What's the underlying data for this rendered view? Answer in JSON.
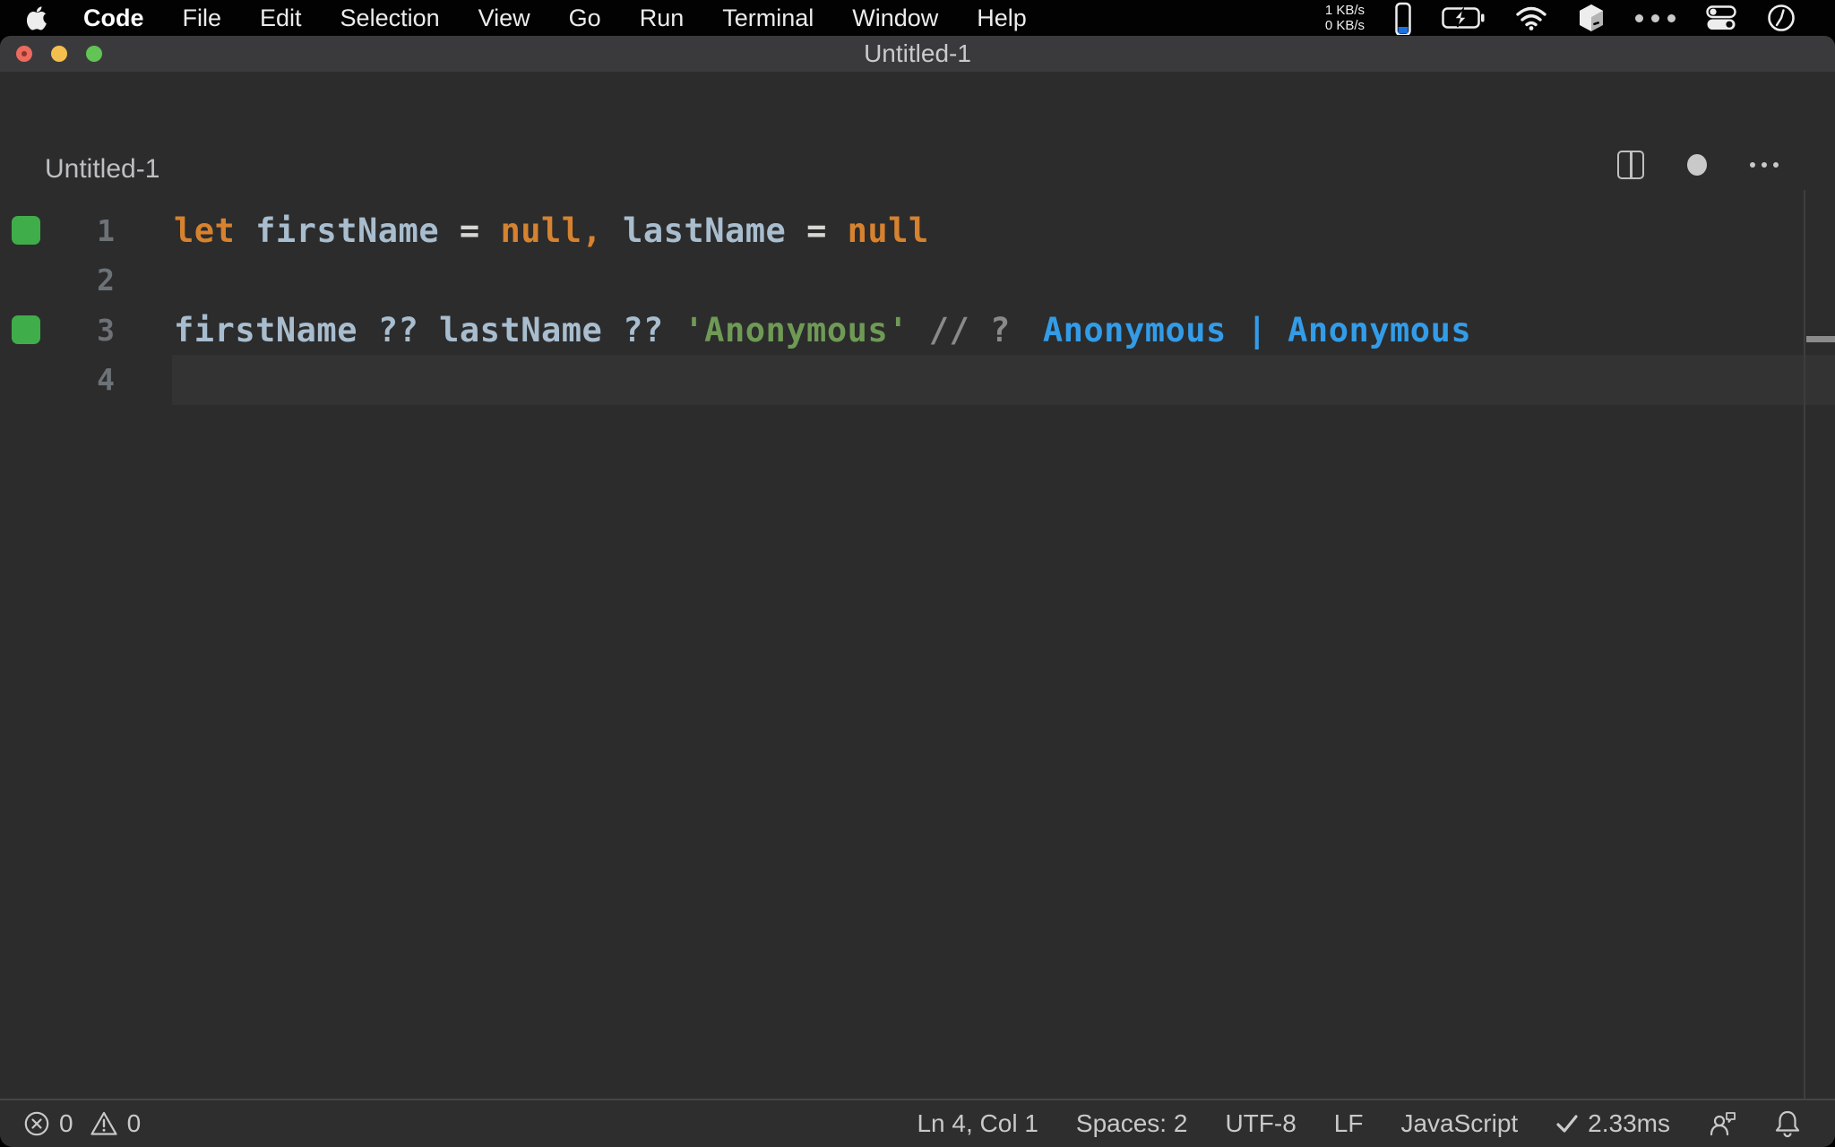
{
  "menu_bar": {
    "items": [
      "Code",
      "File",
      "Edit",
      "Selection",
      "View",
      "Go",
      "Run",
      "Terminal",
      "Window",
      "Help"
    ],
    "network": {
      "up": "1 KB/s",
      "down": "0 KB/s"
    }
  },
  "window": {
    "title": "Untitled-1"
  },
  "editor_header": {
    "tab_title": "Untitled-1"
  },
  "code": {
    "line1": {
      "number": "1",
      "tokens": {
        "kw_let": "let ",
        "id_first": "firstName ",
        "op_eq1": "= ",
        "kw_null1": "null",
        "punct_comma": ", ",
        "id_last": "lastName ",
        "op_eq2": "= ",
        "kw_null2": "null"
      }
    },
    "line2": {
      "number": "2"
    },
    "line3": {
      "number": "3",
      "tokens": {
        "id_first": "firstName ",
        "op_q1": "?? ",
        "id_last": "lastName ",
        "op_q2": "?? ",
        "str": "'Anonymous'",
        "comment": " // ?"
      },
      "inline_value": "Anonymous | Anonymous"
    },
    "line4": {
      "number": "4"
    }
  },
  "status_bar": {
    "errors": "0",
    "warnings": "0",
    "cursor": "Ln 4, Col 1",
    "indentation": "Spaces: 2",
    "encoding": "UTF-8",
    "eol": "LF",
    "language": "JavaScript",
    "perf": "2.33ms"
  },
  "colors": {
    "keyword_orange": "#d6822f",
    "identifier_blue_gray": "#a8bdce",
    "string_green": "#6f9a56",
    "comment_gray": "#8a8a8a",
    "inline_value_blue": "#339ce8",
    "coverage_green": "#3fae4a",
    "gauge_blue": "#1f6fe0",
    "editor_bg": "#2c2c2c",
    "titlebar_bg": "#3a3a3c"
  }
}
